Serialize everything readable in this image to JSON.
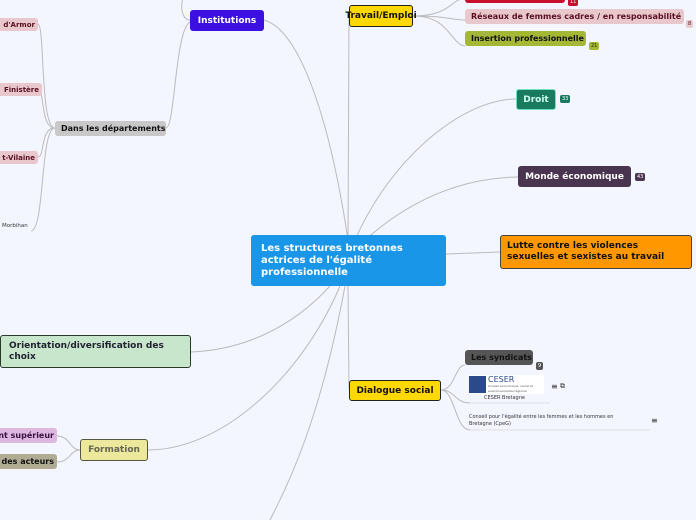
{
  "central": {
    "label": "Les structures bretonnes actrices de l'égalité professionnelle",
    "color": "#1a96e8"
  },
  "institutions": {
    "label": "Institutions",
    "children": {
      "departements": {
        "label": "Dans les départements",
        "items": [
          "d'Armor",
          "Finistère",
          "t-Vilaine",
          "Morbihan"
        ]
      }
    }
  },
  "travail": {
    "label": "Travail/Emploi",
    "top_badge": "11",
    "reseaux": {
      "label": "Réseaux de femmes cadres / en responsabilité",
      "badge": "8"
    },
    "insertion": {
      "label": "Insertion professionnelle",
      "badge": "21"
    }
  },
  "droit": {
    "label": "Droit",
    "badge": "33"
  },
  "monde": {
    "label": "Monde économique",
    "badge": "43"
  },
  "lutte": {
    "label": "Lutte contre les violences sexuelles et sexistes au travail"
  },
  "dialogue": {
    "label": "Dialogue social",
    "syndicats": {
      "label": "Les syndicats",
      "badge": "9"
    },
    "ceser": {
      "logo_title": "CESER",
      "logo_sub": "Conseil économique, social et environnemental régional",
      "label": "CESER Bretagne",
      "notes_icon": "≡",
      "link_icon": "⧉"
    },
    "cpeg": {
      "label": "Conseil pour l'égalité entre les femmes et les hommes en Bretagne (CpeG)",
      "notes_icon": "≡"
    }
  },
  "orientation": {
    "label": "Orientation/diversification des choix"
  },
  "formation": {
    "label": "Formation",
    "items": [
      "nt supérieur",
      "des acteurs"
    ]
  }
}
